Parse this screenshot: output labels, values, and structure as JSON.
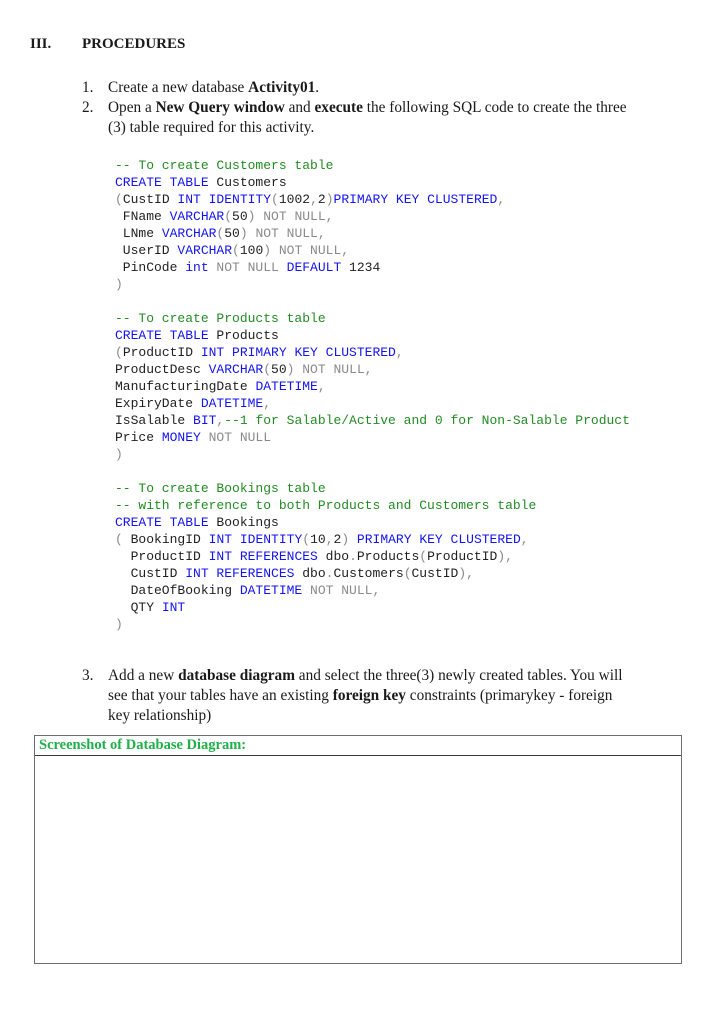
{
  "section": {
    "number": "III.",
    "title": "PROCEDURES"
  },
  "steps": [
    {
      "number": "1.",
      "lines": [
        [
          {
            "t": "Create a new database "
          },
          {
            "t": "Activity01",
            "b": true
          },
          {
            "t": "."
          }
        ]
      ]
    },
    {
      "number": "2.",
      "lines": [
        [
          {
            "t": "Open a "
          },
          {
            "t": "New Query window",
            "b": true
          },
          {
            "t": " and "
          },
          {
            "t": "execute",
            "b": true
          },
          {
            "t": " the following SQL code to create the three"
          }
        ],
        [
          {
            "t": "(3) table required for this activity."
          }
        ]
      ]
    },
    {
      "number": "3.",
      "lines": [
        [
          {
            "t": "Add a new "
          },
          {
            "t": "database diagram",
            "b": true
          },
          {
            "t": " and select the three(3) newly created tables. You will"
          }
        ],
        [
          {
            "t": "see that your tables have an existing "
          },
          {
            "t": "foreign key",
            "b": true
          },
          {
            "t": " constraints (primarykey - foreign"
          }
        ],
        [
          {
            "t": "key relationship)"
          }
        ]
      ]
    }
  ],
  "code": [
    [
      [
        "comment",
        "-- To create Customers table"
      ]
    ],
    [
      [
        "keyword",
        "CREATE TABLE"
      ],
      [
        "text",
        " Customers"
      ]
    ],
    [
      [
        "gray",
        "("
      ],
      [
        "text",
        "CustID "
      ],
      [
        "keyword",
        "INT IDENTITY"
      ],
      [
        "gray",
        "("
      ],
      [
        "text",
        "1002"
      ],
      [
        "gray",
        ","
      ],
      [
        "text",
        "2"
      ],
      [
        "gray",
        ")"
      ],
      [
        "keyword",
        "PRIMARY KEY CLUSTERED"
      ],
      [
        "gray",
        ","
      ]
    ],
    [
      [
        "text",
        " FName "
      ],
      [
        "keyword",
        "VARCHAR"
      ],
      [
        "gray",
        "("
      ],
      [
        "text",
        "50"
      ],
      [
        "gray",
        ") NOT NULL,"
      ]
    ],
    [
      [
        "text",
        " LNme "
      ],
      [
        "keyword",
        "VARCHAR"
      ],
      [
        "gray",
        "("
      ],
      [
        "text",
        "50"
      ],
      [
        "gray",
        ") NOT NULL,"
      ]
    ],
    [
      [
        "text",
        " UserID "
      ],
      [
        "keyword",
        "VARCHAR"
      ],
      [
        "gray",
        "("
      ],
      [
        "text",
        "100"
      ],
      [
        "gray",
        ") NOT NULL,"
      ]
    ],
    [
      [
        "text",
        " PinCode "
      ],
      [
        "keyword",
        "int"
      ],
      [
        "gray",
        " NOT NULL "
      ],
      [
        "keyword",
        "DEFAULT"
      ],
      [
        "text",
        " 1234"
      ]
    ],
    [
      [
        "gray",
        ")"
      ]
    ],
    [],
    [
      [
        "comment",
        "-- To create Products table"
      ]
    ],
    [
      [
        "keyword",
        "CREATE TABLE"
      ],
      [
        "text",
        " Products"
      ]
    ],
    [
      [
        "gray",
        "("
      ],
      [
        "text",
        "ProductID "
      ],
      [
        "keyword",
        "INT PRIMARY KEY CLUSTERED"
      ],
      [
        "gray",
        ","
      ]
    ],
    [
      [
        "text",
        "ProductDesc "
      ],
      [
        "keyword",
        "VARCHAR"
      ],
      [
        "gray",
        "("
      ],
      [
        "text",
        "50"
      ],
      [
        "gray",
        ") NOT NULL,"
      ]
    ],
    [
      [
        "text",
        "ManufacturingDate "
      ],
      [
        "keyword",
        "DATETIME"
      ],
      [
        "gray",
        ","
      ]
    ],
    [
      [
        "text",
        "ExpiryDate "
      ],
      [
        "keyword",
        "DATETIME"
      ],
      [
        "gray",
        ","
      ]
    ],
    [
      [
        "text",
        "IsSalable "
      ],
      [
        "keyword",
        "BIT"
      ],
      [
        "gray",
        ","
      ],
      [
        "comment",
        "--1 for Salable/Active and 0 for Non-Salable Product"
      ]
    ],
    [
      [
        "text",
        "Price "
      ],
      [
        "keyword",
        "MONEY"
      ],
      [
        "gray",
        " NOT NULL"
      ]
    ],
    [
      [
        "gray",
        ")"
      ]
    ],
    [],
    [
      [
        "comment",
        "-- To create Bookings table"
      ]
    ],
    [
      [
        "comment",
        "-- with reference to both Products and Customers table"
      ]
    ],
    [
      [
        "keyword",
        "CREATE TABLE"
      ],
      [
        "text",
        " Bookings"
      ]
    ],
    [
      [
        "gray",
        "("
      ],
      [
        "text",
        " BookingID "
      ],
      [
        "keyword",
        "INT IDENTITY"
      ],
      [
        "gray",
        "("
      ],
      [
        "text",
        "10"
      ],
      [
        "gray",
        ","
      ],
      [
        "text",
        "2"
      ],
      [
        "gray",
        ") "
      ],
      [
        "keyword",
        "PRIMARY KEY CLUSTERED"
      ],
      [
        "gray",
        ","
      ]
    ],
    [
      [
        "text",
        "  ProductID "
      ],
      [
        "keyword",
        "INT REFERENCES"
      ],
      [
        "text",
        " dbo"
      ],
      [
        "gray",
        "."
      ],
      [
        "text",
        "Products"
      ],
      [
        "gray",
        "("
      ],
      [
        "text",
        "ProductID"
      ],
      [
        "gray",
        "),"
      ]
    ],
    [
      [
        "text",
        "  CustID "
      ],
      [
        "keyword",
        "INT REFERENCES"
      ],
      [
        "text",
        " dbo"
      ],
      [
        "gray",
        "."
      ],
      [
        "text",
        "Customers"
      ],
      [
        "gray",
        "("
      ],
      [
        "text",
        "CustID"
      ],
      [
        "gray",
        "),"
      ]
    ],
    [
      [
        "text",
        "  DateOfBooking "
      ],
      [
        "keyword",
        "DATETIME"
      ],
      [
        "gray",
        " NOT NULL,"
      ]
    ],
    [
      [
        "text",
        "  QTY "
      ],
      [
        "keyword",
        "INT"
      ]
    ],
    [
      [
        "gray",
        ")"
      ]
    ]
  ],
  "screenshot_box": {
    "header": "Screenshot of Database Diagram:",
    "content": ""
  },
  "colors": {
    "comment": "#238b23",
    "keyword": "#1414f0",
    "gray": "#8a8a8a",
    "box_header": "#1fb04a"
  }
}
